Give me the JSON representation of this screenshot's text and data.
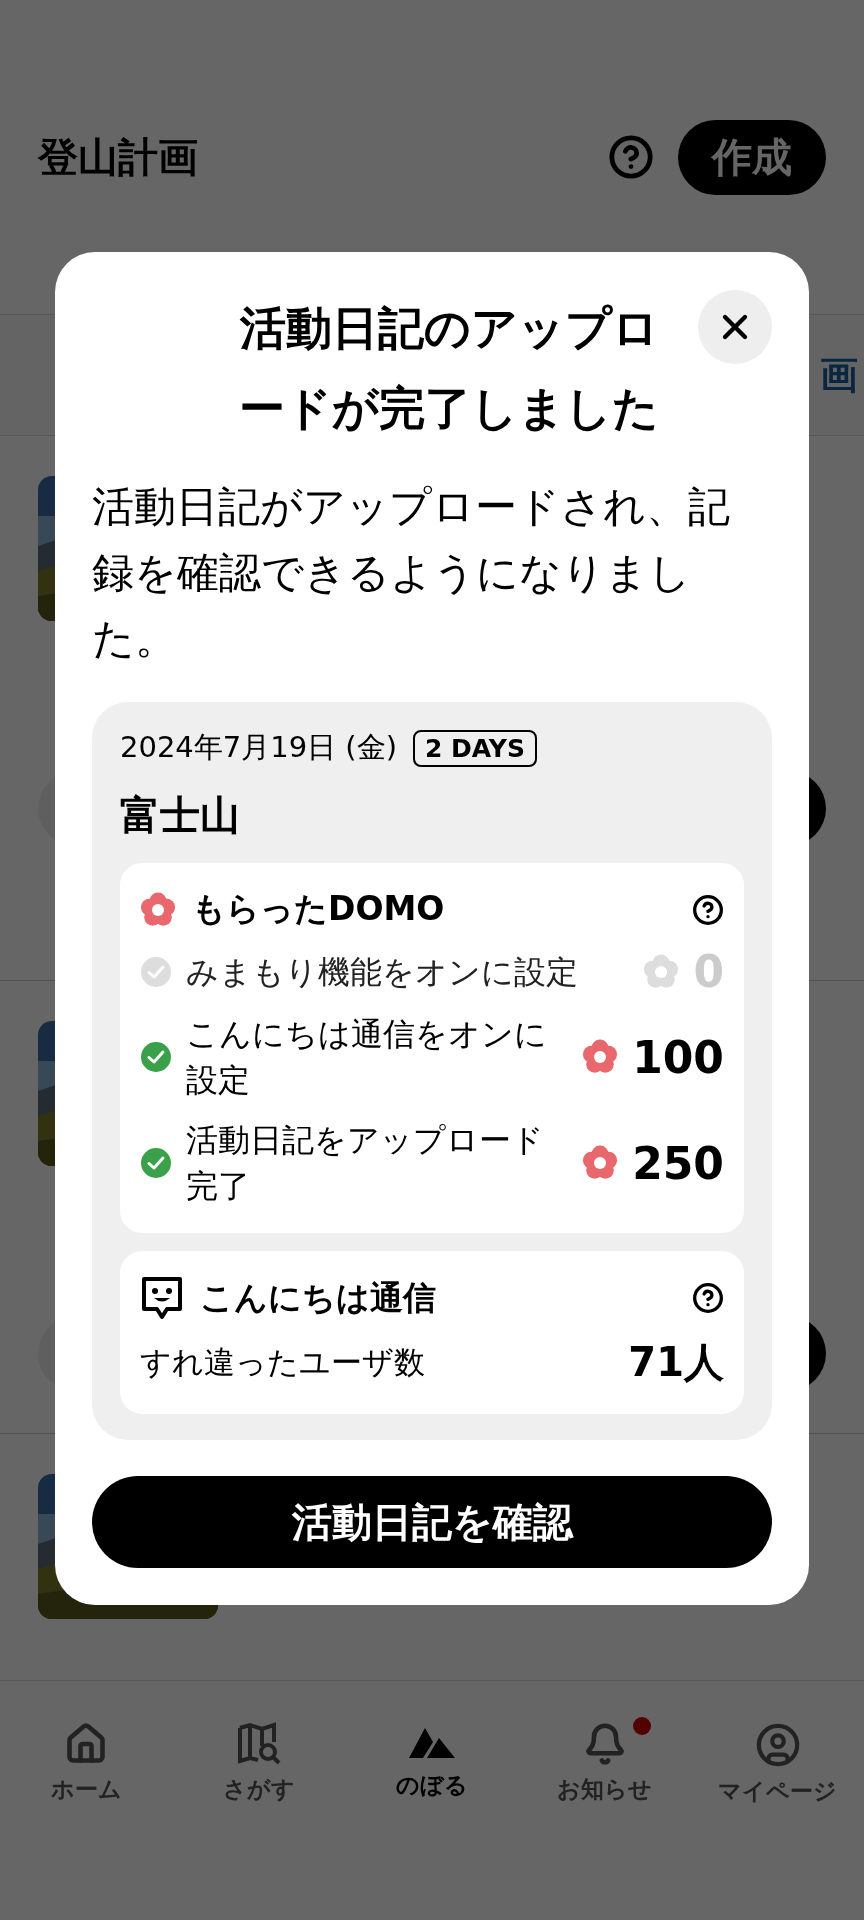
{
  "header": {
    "title": "登山計画",
    "create_button": "作成"
  },
  "tabs": [
    {
      "label": "画",
      "selected": true
    }
  ],
  "modal": {
    "title": "活動日記のアップロードが完了しました",
    "message": "活動日記がアップロードされ、記録を確認できるようになりました。",
    "activity": {
      "date": "2024年7月19日 (金)",
      "duration": "2 DAYS",
      "mountain": "富士山"
    },
    "domo": {
      "title": "もらったDOMO",
      "items": [
        {
          "label": "みまもり機能をオンに設定",
          "points": "0",
          "done": false
        },
        {
          "label": "こんにちは通信をオンに設定",
          "points": "100",
          "done": true
        },
        {
          "label": "活動日記をアップロード完了",
          "points": "250",
          "done": true
        }
      ]
    },
    "encounter": {
      "title": "こんにちは通信",
      "label": "すれ違ったユーザ数",
      "value": "71人"
    },
    "button": "活動日記を確認"
  },
  "nav": [
    {
      "label": "ホーム",
      "selected": false,
      "unread": false
    },
    {
      "label": "さがす",
      "selected": false,
      "unread": false
    },
    {
      "label": "のぼる",
      "selected": true,
      "unread": false
    },
    {
      "label": "お知らせ",
      "selected": false,
      "unread": true
    },
    {
      "label": "マイページ",
      "selected": false,
      "unread": false
    }
  ]
}
